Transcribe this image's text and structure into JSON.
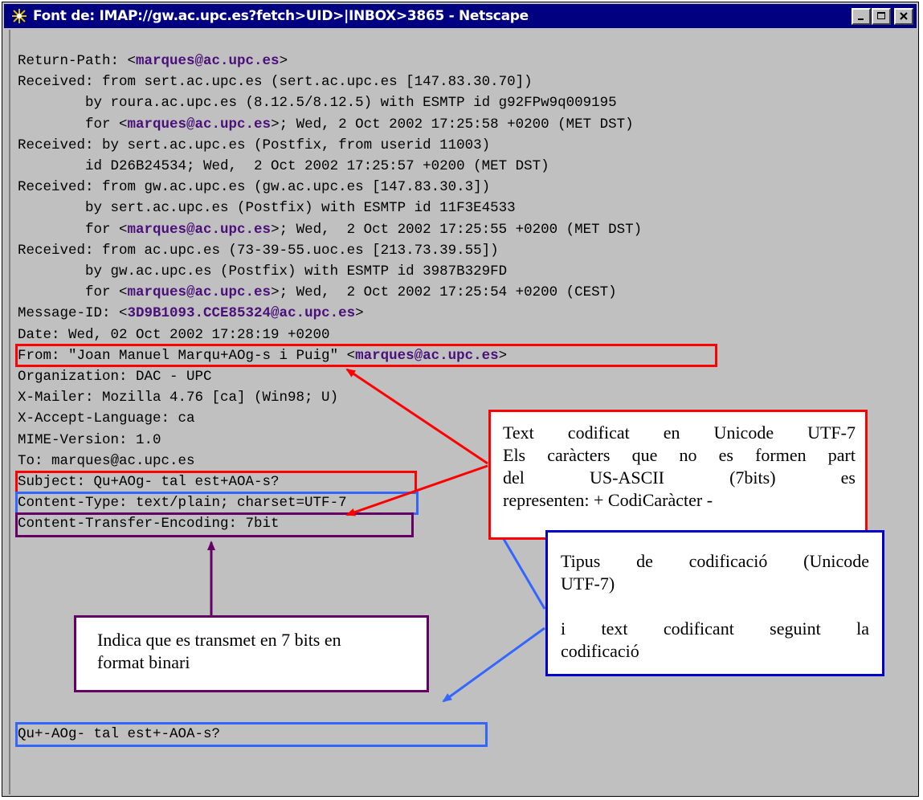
{
  "window": {
    "title": "Font de: IMAP://gw.ac.upc.es?fetch>UID>|INBOX>3865 - Netscape",
    "buttons": {
      "minimize": "_",
      "maximize": "□",
      "close": "×"
    }
  },
  "headers": {
    "l01": {
      "pre": "Return-Path: <",
      "addr": "marques@ac.upc.es",
      "post": ">"
    },
    "l02": "Received: from sert.ac.upc.es (sert.ac.upc.es [147.83.30.70])",
    "l03": "        by roura.ac.upc.es (8.12.5/8.12.5) with ESMTP id g92FPw9q009195",
    "l04": {
      "pre": "        for <",
      "addr": "marques@ac.upc.es",
      "post": ">; Wed, 2 Oct 2002 17:25:58 +0200 (MET DST)"
    },
    "l05": "Received: by sert.ac.upc.es (Postfix, from userid 11003)",
    "l06": "        id D26B24534; Wed,  2 Oct 2002 17:25:57 +0200 (MET DST)",
    "l07": "Received: from gw.ac.upc.es (gw.ac.upc.es [147.83.30.3])",
    "l08": "        by sert.ac.upc.es (Postfix) with ESMTP id 11F3E4533",
    "l09": {
      "pre": "        for <",
      "addr": "marques@ac.upc.es",
      "post": ">; Wed,  2 Oct 2002 17:25:55 +0200 (MET DST)"
    },
    "l10": "Received: from ac.upc.es (73-39-55.uoc.es [213.73.39.55])",
    "l11": "        by gw.ac.upc.es (Postfix) with ESMTP id 3987B329FD",
    "l12": {
      "pre": "        for <",
      "addr": "marques@ac.upc.es",
      "post": ">; Wed,  2 Oct 2002 17:25:54 +0200 (CEST)"
    },
    "l13": {
      "pre": "Message-ID: <",
      "addr": "3D9B1093.CCE85324@ac.upc.es",
      "post": ">"
    },
    "l14": "Date: Wed, 02 Oct 2002 17:28:19 +0200",
    "l15": {
      "pre": "From: \"Joan Manuel Marqu+AOg-s i Puig\" <",
      "addr": "marques@ac.upc.es",
      "post": ">"
    },
    "l16": "Organization: DAC - UPC",
    "l17": "X-Mailer: Mozilla 4.76 [ca] (Win98; U)",
    "l18": "X-Accept-Language: ca",
    "l19": "MIME-Version: 1.0",
    "l20": "To: marques@ac.upc.es",
    "l21": "Subject: Qu+AOg- tal est+AOA-s?",
    "l22": "Content-Type: text/plain; charset=UTF-7",
    "l23": "Content-Transfer-Encoding: 7bit",
    "body": "Qu+-AOg- tal est+-AOA-s?"
  },
  "annotations": {
    "utf7": {
      "line1": "Text codificat en Unicode UTF-7",
      "line2": "Els caràcters que no es formen part",
      "line3": "del US-ASCII (7bits) es",
      "line4": "representen: + CodiCaràcter -"
    },
    "encoding_type": {
      "line1": "Tipus de codificació (Unicode",
      "line2": "UTF-7)",
      "line3": "i text codificant seguint la",
      "line4": "codificació"
    },
    "seven_bit": {
      "line1": "Indica que es transmet en 7 bits en",
      "line2": "format binari"
    }
  },
  "colors": {
    "titlebar": "#000080",
    "window_bg": "#c0c0c0",
    "address": "#4a0f7a",
    "red": "#ff0000",
    "blue": "#3366ff",
    "purple": "#660066",
    "dark_blue": "#0000cc"
  }
}
